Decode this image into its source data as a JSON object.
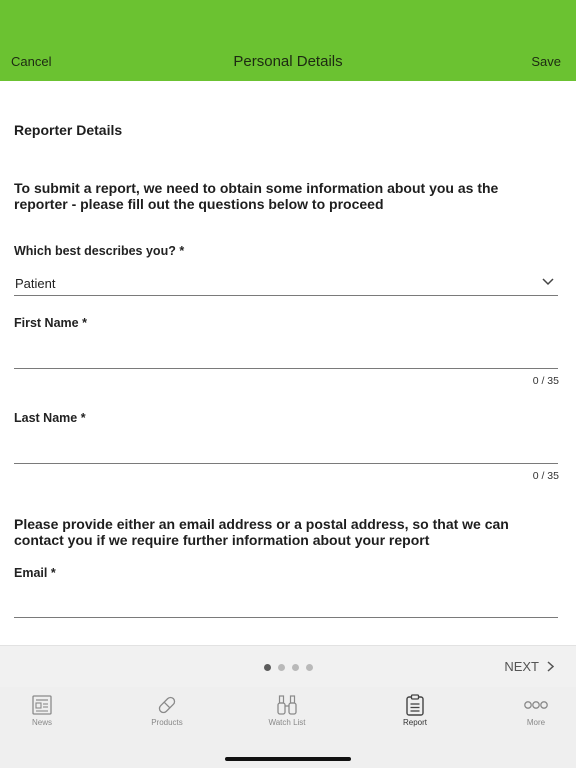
{
  "header": {
    "cancel_label": "Cancel",
    "title": "Personal Details",
    "save_label": "Save",
    "accent_color": "#6bc231"
  },
  "form": {
    "section_title": "Reporter Details",
    "intro_text": "To submit a report, we need to obtain some information about you as the reporter - please fill out the questions below to proceed",
    "describe": {
      "label": "Which best describes you? *",
      "value": "Patient",
      "icon": "chevron-down-icon"
    },
    "first_name": {
      "label": "First Name *",
      "value": "",
      "counter": "0 / 35"
    },
    "last_name": {
      "label": "Last Name *",
      "value": "",
      "counter": "0 / 35"
    },
    "contact_text": "Please provide either an email address or a postal address, so that we can contact you if we require further information about your report",
    "email": {
      "label": "Email *",
      "value": ""
    }
  },
  "pager": {
    "page_count": 4,
    "current_page": 1,
    "next_label": "NEXT"
  },
  "tabbar": {
    "items": [
      {
        "label": "News",
        "icon": "news-icon",
        "active": false
      },
      {
        "label": "Products",
        "icon": "pill-icon",
        "active": false
      },
      {
        "label": "Watch List",
        "icon": "binoculars-icon",
        "active": false
      },
      {
        "label": "Report",
        "icon": "clipboard-icon",
        "active": true
      },
      {
        "label": "More",
        "icon": "more-icon",
        "active": false
      }
    ]
  }
}
